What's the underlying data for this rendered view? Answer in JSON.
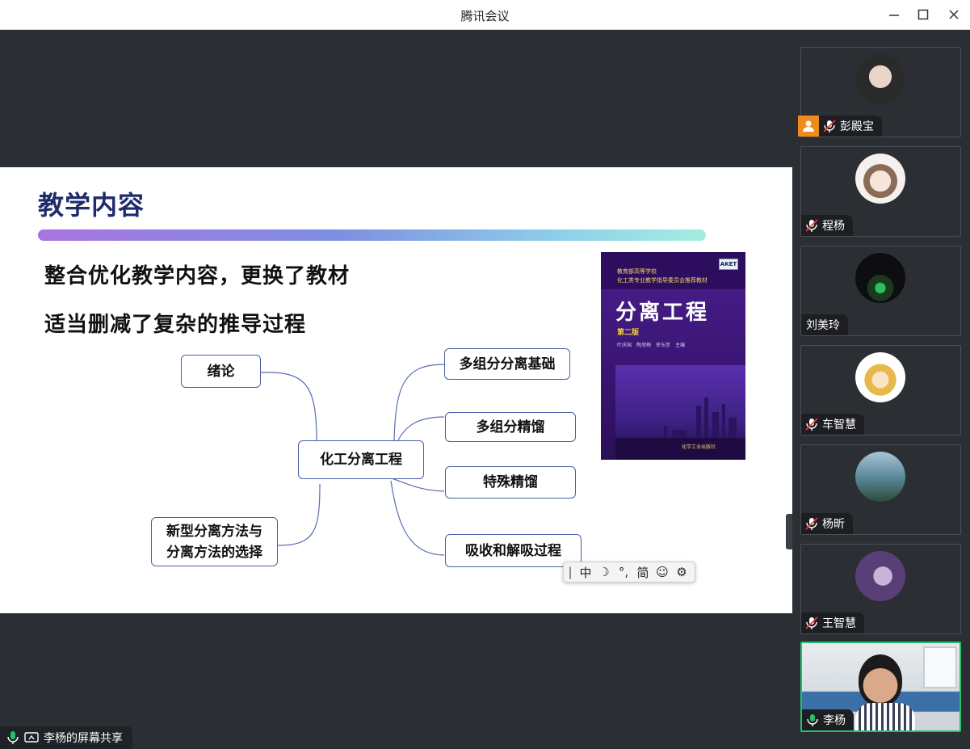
{
  "window": {
    "title": "腾讯会议",
    "minimize_icon": "minimize-icon",
    "maximize_icon": "maximize-icon",
    "close_icon": "close-icon"
  },
  "slide": {
    "title": "教学内容",
    "bullets": [
      "整合优化教学内容，更换了教材",
      "适当删减了复杂的推导过程"
    ],
    "mindmap": {
      "center": "化工分离工程",
      "left_top": "绪论",
      "left_bottom_line1": "新型分离方法与",
      "left_bottom_line2": "分离方法的选择",
      "right": [
        "多组分分离基础",
        "多组分精馏",
        "特殊精馏",
        "吸收和解吸过程"
      ]
    },
    "book": {
      "publisher_line1": "教育部高等学校",
      "publisher_line2": "化工类专业教学指导委员会推荐教材",
      "logo": "AKET",
      "title": "分离工程",
      "edition": "第二版",
      "authors": "叶庆国　陶旭梅　徐东彦　主编",
      "publisher": "化学工业出版社"
    }
  },
  "ime": {
    "cursor": "|",
    "lang": "中",
    "moon": "☽",
    "punct": "°,",
    "mode": "简",
    "emoji": "☺",
    "settings": "⚙"
  },
  "share_label": "李杨的屏幕共享",
  "participants": [
    {
      "name": "彭殿宝",
      "host": true,
      "muted": true
    },
    {
      "name": "程杨",
      "host": false,
      "muted": true
    },
    {
      "name": "刘美玲",
      "host": false,
      "muted": false,
      "no_mic": true
    },
    {
      "name": "车智慧",
      "host": false,
      "muted": true
    },
    {
      "name": "杨昕",
      "host": false,
      "muted": true
    },
    {
      "name": "王智慧",
      "host": false,
      "muted": true
    },
    {
      "name": "李杨",
      "host": false,
      "muted": false,
      "speaking": true
    }
  ],
  "colors": {
    "accent_green": "#22c36b",
    "host_orange": "#f08a1c",
    "muted_red": "#e5383b",
    "slide_title": "#1e2c6b"
  }
}
